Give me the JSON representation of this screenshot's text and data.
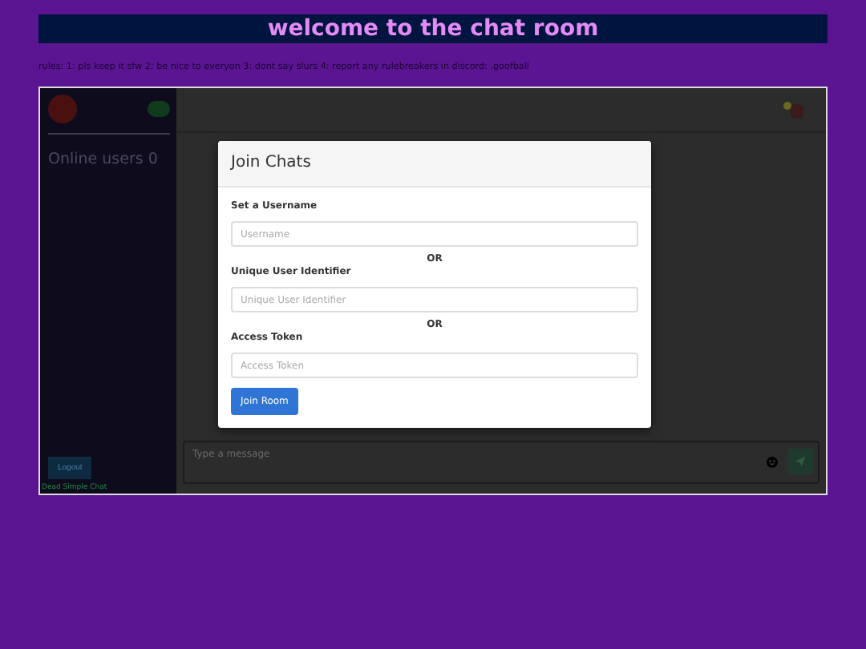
{
  "header": {
    "title": "welcome to the chat room"
  },
  "rules": "rules: 1: pls keep it sfw 2: be nice to everyon 3: dont say slurs 4: report any rulebreakers in discord: .goofball",
  "chat": {
    "sidebar": {
      "online_label": "Online users 0",
      "logout": "Logout",
      "footer": "Dead Simple Chat"
    },
    "message_input": {
      "placeholder": "Type a message"
    },
    "modal": {
      "title": "Join Chats",
      "fields": [
        {
          "label": "Set a Username",
          "placeholder": "Username"
        },
        {
          "label": "Unique User Identifier",
          "placeholder": "Unique User Identifier"
        },
        {
          "label": "Access Token",
          "placeholder": "Access Token"
        }
      ],
      "separators": [
        "OR",
        "OR"
      ],
      "button": "Join Room"
    }
  }
}
